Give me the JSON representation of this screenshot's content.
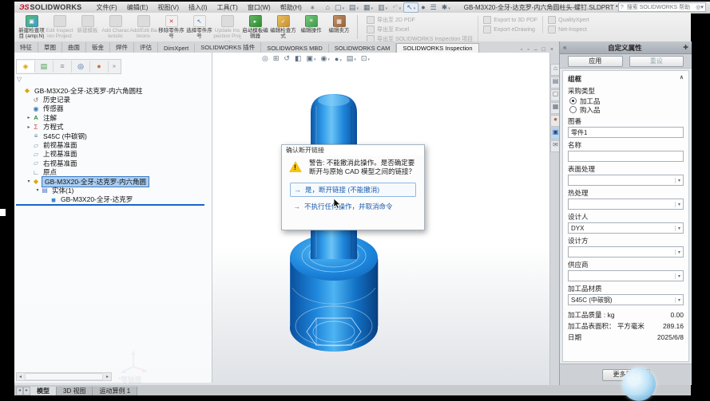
{
  "window": {
    "brand_ds": "ЭS",
    "brand_name": "SOLIDWORKS",
    "title": "GB-M3X20-全牙-达克罗-内六角圆柱头-螺钉.SLDPRT *",
    "search_placeholder": "搜索 SOLIDWORKS 帮助",
    "pin_glyph": "∗",
    "help_glyph": "?",
    "minimize_glyph": "—",
    "restore_glyph": "❏",
    "close_glyph": "✕",
    "login_glyph": "◔"
  },
  "menu": {
    "items": [
      {
        "label": "文件(F)"
      },
      {
        "label": "编辑(E)"
      },
      {
        "label": "视图(V)"
      },
      {
        "label": "插入(I)"
      },
      {
        "label": "工具(T)"
      },
      {
        "label": "窗口(W)"
      },
      {
        "label": "帮助(H)"
      }
    ]
  },
  "qat": {
    "items": [
      {
        "name": "home",
        "glyph": "⌂"
      },
      {
        "name": "new-file",
        "glyph": "▢",
        "dd": true
      },
      {
        "name": "open-file",
        "glyph": "▤",
        "dd": true
      },
      {
        "name": "save",
        "glyph": "▦",
        "dd": true
      },
      {
        "name": "print",
        "glyph": "▥",
        "dd": true
      },
      {
        "name": "undo",
        "glyph": "↶",
        "dd": true,
        "disabled": true
      },
      {
        "name": "select-arrow",
        "glyph": "↖",
        "dd": true,
        "boxed": true
      },
      {
        "name": "rebuild",
        "glyph": "●"
      },
      {
        "name": "file-properties",
        "glyph": "☰"
      },
      {
        "name": "options",
        "glyph": "✱",
        "dd": true
      }
    ]
  },
  "ribbon": {
    "buttons": [
      {
        "label": "新建检查项目 (amp;N)",
        "icon": "new-inspection",
        "glyph": "▣"
      },
      {
        "label": "Edit Inspection Project",
        "icon": "edit-project",
        "glyph": "",
        "disabled": true
      },
      {
        "label": "新建模板",
        "icon": "new-template",
        "glyph": "",
        "disabled": true
      },
      {
        "label": "Add Characteristic",
        "icon": "add-characteristic",
        "glyph": "",
        "disabled": true
      },
      {
        "label": "Add/Edit Balloons",
        "icon": "add-balloons",
        "glyph": "",
        "disabled": true
      },
      {
        "label": "移除零件序号",
        "icon": "remove-balloon",
        "glyph": "✕"
      },
      {
        "label": "选择零件序号",
        "icon": "select-balloon",
        "glyph": "↖"
      },
      {
        "label": "Update Inspection Project",
        "icon": "update-project",
        "glyph": "",
        "disabled": true
      },
      {
        "label": "启动模板编辑器",
        "icon": "launch-editor",
        "glyph": "▸"
      },
      {
        "label": "编辑检查方式",
        "icon": "edit-method",
        "glyph": "✓"
      },
      {
        "label": "编辑操作",
        "icon": "edit-operation",
        "glyph": "≡"
      },
      {
        "label": "编辑卖方",
        "icon": "edit-vendor",
        "glyph": "▦"
      }
    ],
    "export_col1": [
      {
        "label": "导出至 2D PDF"
      },
      {
        "label": "导出至 Excel"
      },
      {
        "label": "导出至 SOLIDWORKS Inspection 项目"
      }
    ],
    "export_col2": [
      {
        "label": "Export to 3D PDF"
      },
      {
        "label": "Export eDrawing"
      }
    ],
    "export_col3": [
      {
        "label": "QualityXpert"
      },
      {
        "label": "Net-Inspect"
      }
    ]
  },
  "command_tabs": {
    "items": [
      {
        "label": "特征"
      },
      {
        "label": "草图"
      },
      {
        "label": "曲面"
      },
      {
        "label": "钣金"
      },
      {
        "label": "焊件"
      },
      {
        "label": "评估"
      },
      {
        "label": "DimXpert"
      },
      {
        "label": "SOLIDWORKS 插件"
      },
      {
        "label": "SOLIDWORKS MBD"
      },
      {
        "label": "SOLIDWORKS CAM"
      },
      {
        "label": "SOLIDWORKS Inspection",
        "active": true
      }
    ],
    "doc_controls": [
      {
        "name": "new-window",
        "glyph": "▫"
      },
      {
        "name": "tile-window",
        "glyph": "▫"
      },
      {
        "name": "doc-minimize",
        "glyph": "–"
      },
      {
        "name": "doc-restore",
        "glyph": "□"
      },
      {
        "name": "doc-close",
        "glyph": "×"
      }
    ]
  },
  "fm_tabs": {
    "items": [
      {
        "name": "features",
        "glyph": "◈",
        "active": true
      },
      {
        "name": "properties",
        "glyph": "▤"
      },
      {
        "name": "configurations",
        "glyph": "≡"
      },
      {
        "name": "dimxpert",
        "glyph": "◎"
      },
      {
        "name": "display",
        "glyph": "●"
      }
    ],
    "more_glyph": "»",
    "filter_glyph": "▽"
  },
  "tree": {
    "items": [
      {
        "label": "GB-M3X20-全牙-达克罗-内六角圆柱",
        "icon": "part",
        "level": 0,
        "arrow": ""
      },
      {
        "label": "历史记录",
        "icon": "history",
        "level": 1,
        "arrow": ""
      },
      {
        "label": "传感器",
        "icon": "sensors",
        "level": 1,
        "arrow": ""
      },
      {
        "label": "注解",
        "icon": "annotations",
        "level": 1,
        "arrow": "▸"
      },
      {
        "label": "方程式",
        "icon": "equations",
        "level": 1,
        "arrow": "▸"
      },
      {
        "label": "S45C (中碳钢)",
        "icon": "material",
        "level": 1,
        "arrow": ""
      },
      {
        "label": "前视基准面",
        "icon": "plane",
        "level": 1,
        "arrow": ""
      },
      {
        "label": "上视基准面",
        "icon": "plane",
        "level": 1,
        "arrow": ""
      },
      {
        "label": "右视基准面",
        "icon": "plane",
        "level": 1,
        "arrow": ""
      },
      {
        "label": "原点",
        "icon": "origin",
        "level": 1,
        "arrow": ""
      },
      {
        "label": "GB-M3X20-全牙-达克罗-内六角圆",
        "icon": "imported",
        "level": 1,
        "arrow": "▾",
        "selected": true
      },
      {
        "label": "实体(1)",
        "icon": "bodies-folder",
        "level": 2,
        "arrow": "▾"
      },
      {
        "label": "GB-M3X20-全牙-达克罗",
        "icon": "body",
        "level": 3,
        "arrow": ""
      }
    ]
  },
  "hud": {
    "items": [
      {
        "name": "zoom-fit",
        "glyph": "◎"
      },
      {
        "name": "zoom-area",
        "glyph": "⊞"
      },
      {
        "name": "previous-view",
        "glyph": "↺"
      },
      {
        "name": "section-view",
        "glyph": "◧"
      },
      {
        "name": "display-style",
        "glyph": "▣",
        "dd": true
      },
      {
        "name": "hide-show-items",
        "glyph": "◉",
        "dd": true
      },
      {
        "name": "edit-appearance",
        "glyph": "●",
        "dd": true
      },
      {
        "name": "apply-scene",
        "glyph": "▤",
        "dd": true
      },
      {
        "name": "view-settings",
        "glyph": "⊡",
        "dd": true
      }
    ]
  },
  "graphics": {
    "view_label": "*等轴测",
    "model_color": "#1588e8"
  },
  "dialog": {
    "title": "确认断开链接",
    "message": "警告: 不能撤消此操作。是否确定要断开与原始 CAD 模型之间的链接？",
    "option_yes": "是，断开链接 (不能撤消)",
    "option_cancel": "不执行任何操作，并取消命令",
    "arrow_glyph": "→"
  },
  "taskpane": {
    "items": [
      {
        "name": "resources",
        "glyph": "⌂"
      },
      {
        "name": "design-library",
        "glyph": "▤"
      },
      {
        "name": "file-explorer",
        "glyph": "▢"
      },
      {
        "name": "view-palette",
        "glyph": "▦"
      },
      {
        "name": "appearances",
        "glyph": "●"
      },
      {
        "name": "custom-properties",
        "glyph": "▣",
        "selected": true
      },
      {
        "name": "forum",
        "glyph": "✉"
      }
    ]
  },
  "panel": {
    "title": "自定义属性",
    "collapse_glyph": "«",
    "pin_glyph": "✚",
    "apply_label": "应用",
    "reset_label": "重设",
    "group_label": "组框",
    "group_caret": "∧",
    "procurement_label": "采购类型",
    "radio_machined": "加工品",
    "radio_purchased": "购入品",
    "fields": [
      {
        "label": "图番",
        "value": "零件1",
        "type": "input"
      },
      {
        "label": "名称",
        "value": "",
        "type": "input"
      },
      {
        "label": "表面处理",
        "value": "",
        "type": "select"
      },
      {
        "label": "热处理",
        "value": "",
        "type": "select"
      },
      {
        "label": "设计人",
        "value": "DYX",
        "type": "select"
      },
      {
        "label": "设计方",
        "value": "",
        "type": "select"
      },
      {
        "label": "供应商",
        "value": "",
        "type": "select"
      },
      {
        "label": "加工品材质",
        "value": "S45C (中碳钢)",
        "type": "select"
      }
    ],
    "stats": [
      {
        "label": "加工品质量 : kg",
        "value": "0.00"
      },
      {
        "label": "加工品表面积： 平方毫米",
        "value": "289.16"
      },
      {
        "label": "日期",
        "value": "2025/6/8"
      }
    ],
    "more_button": "更多属性"
  },
  "bottom": {
    "nav_glyphs": [
      "◂",
      "▸",
      "▪",
      "▪"
    ],
    "tabs": [
      {
        "label": "模型",
        "active": true
      },
      {
        "label": "3D 视图"
      },
      {
        "label": "运动算例 1"
      }
    ]
  }
}
